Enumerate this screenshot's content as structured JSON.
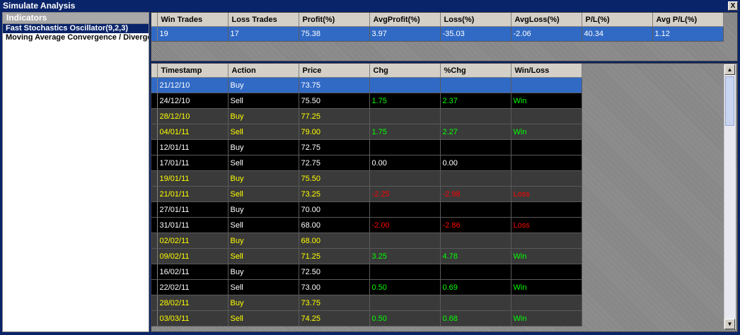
{
  "window": {
    "title": "Simulate Analysis",
    "close": "X"
  },
  "indicators": {
    "header": "Indicators",
    "items": [
      {
        "label": "Fast Stochastics Oscillator(9,2,3)"
      },
      {
        "label": "Moving Average Convergence / Divergence"
      }
    ]
  },
  "summary": {
    "headers": [
      "Win Trades",
      "Loss Trades",
      "Profit(%)",
      "AvgProfit(%)",
      "Loss(%)",
      "AvgLoss(%)",
      "P/L(%)",
      "Avg P/L(%)"
    ],
    "row": [
      "19",
      "17",
      "75.38",
      "3.97",
      "-35.03",
      "-2.06",
      "40.34",
      "1.12"
    ]
  },
  "trades": {
    "headers": [
      "Timestamp",
      "Action",
      "Price",
      "Chg",
      "%Chg",
      "Win/Loss"
    ],
    "rows": [
      {
        "ts": "21/12/10",
        "action": "Buy",
        "price": "73.75",
        "chg": "",
        "pct": "",
        "wl": ""
      },
      {
        "ts": "24/12/10",
        "action": "Sell",
        "price": "75.50",
        "chg": "1.75",
        "pct": "2.37",
        "wl": "Win"
      },
      {
        "ts": "28/12/10",
        "action": "Buy",
        "price": "77.25",
        "chg": "",
        "pct": "",
        "wl": ""
      },
      {
        "ts": "04/01/11",
        "action": "Sell",
        "price": "79.00",
        "chg": "1.75",
        "pct": "2.27",
        "wl": "Win"
      },
      {
        "ts": "12/01/11",
        "action": "Buy",
        "price": "72.75",
        "chg": "",
        "pct": "",
        "wl": ""
      },
      {
        "ts": "17/01/11",
        "action": "Sell",
        "price": "72.75",
        "chg": "0.00",
        "pct": "0.00",
        "wl": ""
      },
      {
        "ts": "19/01/11",
        "action": "Buy",
        "price": "75.50",
        "chg": "",
        "pct": "",
        "wl": ""
      },
      {
        "ts": "21/01/11",
        "action": "Sell",
        "price": "73.25",
        "chg": "-2.25",
        "pct": "-2.98",
        "wl": "Loss"
      },
      {
        "ts": "27/01/11",
        "action": "Buy",
        "price": "70.00",
        "chg": "",
        "pct": "",
        "wl": ""
      },
      {
        "ts": "31/01/11",
        "action": "Sell",
        "price": "68.00",
        "chg": "-2.00",
        "pct": "-2.86",
        "wl": "Loss"
      },
      {
        "ts": "02/02/11",
        "action": "Buy",
        "price": "68.00",
        "chg": "",
        "pct": "",
        "wl": ""
      },
      {
        "ts": "09/02/11",
        "action": "Sell",
        "price": "71.25",
        "chg": "3.25",
        "pct": "4.78",
        "wl": "Win"
      },
      {
        "ts": "16/02/11",
        "action": "Buy",
        "price": "72.50",
        "chg": "",
        "pct": "",
        "wl": ""
      },
      {
        "ts": "22/02/11",
        "action": "Sell",
        "price": "73.00",
        "chg": "0.50",
        "pct": "0.69",
        "wl": "Win"
      },
      {
        "ts": "28/02/11",
        "action": "Buy",
        "price": "73.75",
        "chg": "",
        "pct": "",
        "wl": ""
      },
      {
        "ts": "03/03/11",
        "action": "Sell",
        "price": "74.25",
        "chg": "0.50",
        "pct": "0.68",
        "wl": "Win"
      }
    ]
  },
  "colors": {
    "win": "#00ff00",
    "loss": "#ff0000",
    "yellow_text": "#ffff00",
    "selection": "#316ac5",
    "title_bar": "#0a246a"
  }
}
